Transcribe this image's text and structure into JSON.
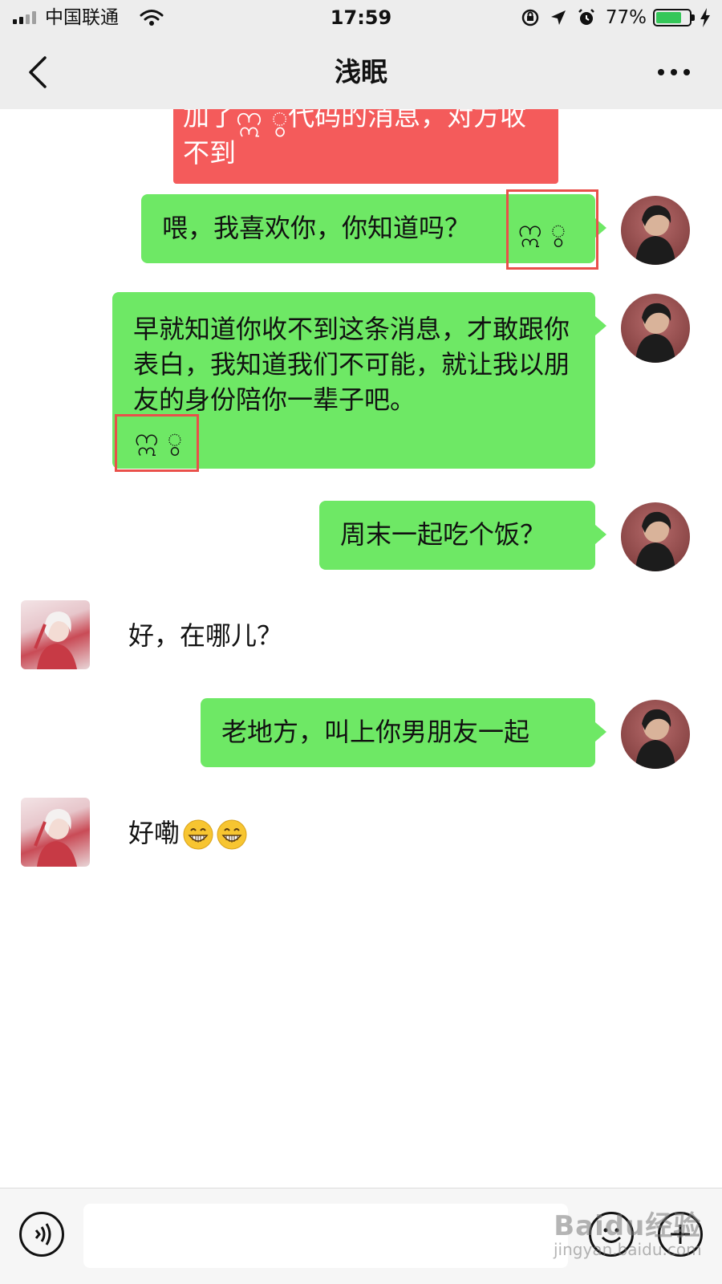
{
  "status_bar": {
    "carrier": "中国联通",
    "time": "17:59",
    "battery_percent_text": "77%",
    "battery_level": 0.77,
    "icons": [
      "signal-icon",
      "wifi-icon",
      "rotation-lock-icon",
      "location-icon",
      "alarm-icon",
      "battery-icon",
      "charging-icon"
    ]
  },
  "nav": {
    "title": "浅眠",
    "back_icon": "chevron-left-icon",
    "more_icon": "more-icon"
  },
  "annotation": {
    "text": "加了ဣ ွ代码的消息，对方收不到"
  },
  "messages": [
    {
      "side": "right",
      "text": "喂，我喜欢你，你知道吗？",
      "code": "ဣ ွ"
    },
    {
      "side": "right",
      "text": "早就知道你收不到这条消息，才敢跟你表白，我知道我们不可能，就让我以朋友的身份陪你一辈子吧。",
      "code": "ဣ ွ"
    },
    {
      "side": "right",
      "text": "周末一起吃个饭？"
    },
    {
      "side": "left",
      "text": "好，在哪儿？"
    },
    {
      "side": "right",
      "text": "老地方，叫上你男朋友一起"
    },
    {
      "side": "left",
      "text": "好嘞",
      "emoji": [
        "grinning-face-emoji",
        "grinning-face-emoji"
      ]
    }
  ],
  "input_bar": {
    "placeholder": "",
    "voice_icon": "voice-icon",
    "emoji_icon": "smile-icon",
    "plus_icon": "plus-icon"
  },
  "watermark": {
    "brand": "Baidu经验",
    "url": "jingyan.baidu.com"
  },
  "colors": {
    "outgoing_bubble": "#6ee865",
    "annotation_bg": "#f45b5b",
    "highlight_border": "#e9504a",
    "chat_bg": "#ffffff",
    "bar_bg": "#ededed"
  }
}
